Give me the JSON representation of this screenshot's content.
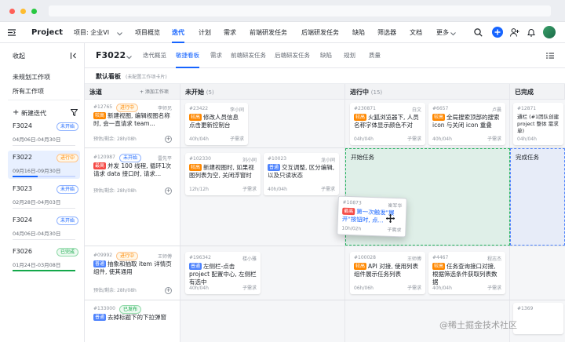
{
  "window": {
    "dots": [
      "#ff5f57",
      "#febc2e",
      "#28c840"
    ]
  },
  "topnav": {
    "app_name": "Project",
    "project_label": "项目: 企业VI",
    "items": [
      "项目概览",
      "迭代",
      "计划",
      "需求",
      "前端研发任务",
      "后端研发任务",
      "缺陷",
      "筛选器",
      "文档"
    ],
    "more": "更多"
  },
  "sidebar": {
    "title": "收起",
    "unplanned": "未规划工作项",
    "all": "所有工作项",
    "new_iteration": "新建迭代",
    "iterations": [
      {
        "name": "F3024",
        "dates": "04月06日-04月30日",
        "status": "未开始",
        "tone": "blue"
      },
      {
        "name": "F3022",
        "dates": "09月16日-09月30日",
        "status": "进行中",
        "tone": "orange"
      },
      {
        "name": "F3023",
        "dates": "02月28日-04月03日",
        "status": "未开始",
        "tone": "blue"
      },
      {
        "name": "F3024",
        "dates": "04月06日-04月30日",
        "status": "未开始",
        "tone": "blue"
      },
      {
        "name": "F3026",
        "dates": "01月24日-03月08日",
        "status": "已完成",
        "tone": "green"
      }
    ]
  },
  "subheader": {
    "iteration": "F3022",
    "tabs": [
      "迭代概览",
      "敏捷看板",
      "需求",
      "前端研发任务",
      "后端研发任务",
      "缺陷",
      "规划",
      "质量"
    ]
  },
  "board": {
    "title": "默认看板",
    "hint": "(未配置工作项卡片)",
    "columns": [
      {
        "name": "泳道",
        "count": ""
      },
      {
        "name": "未开始",
        "count": "(5)"
      },
      {
        "name": "进行中",
        "count": "(15)"
      },
      {
        "name": "已完成",
        "count": ""
      }
    ],
    "lanes": [
      {
        "id": "#12765",
        "status": "进行中",
        "owner": "李师兄",
        "title_tag": "较高",
        "title": "新建视图, 编辑视图名称时, 会一直请求 team...",
        "meta": "预估/剩余: 28h/08h",
        "add": "+ 添加工作项"
      },
      {
        "id": "#120987",
        "status": "未开始",
        "owner": "雷先平",
        "title_tag": "最高",
        "title": "并发 100 线程, 循环1次请求 data 接口时, 请求...",
        "meta": "预估/剩余: 28h/08h"
      },
      {
        "id": "#09992",
        "status": "进行中",
        "owner": "王师傅",
        "title_tag": "普通",
        "title": "抽象和抽取 item 详情页组件, 使其通用",
        "meta": "预估/剩余: 28h/08h"
      },
      {
        "id": "#133000",
        "status": "已发布",
        "owner": "",
        "title_tag": "普通",
        "title": "去掉标题下的下拉弹窗",
        "meta": ""
      }
    ],
    "cards": [
      {
        "id": "#23422",
        "owner": "李小同",
        "tag": "较高",
        "title": "修改人员信息点击更新控制台",
        "meta": "40h/04h",
        "sub": "子需求"
      },
      {
        "id": "#102330",
        "owner": "刘小同",
        "tag": "较高",
        "title": "新建视图时, 如果视图列表为空, 关闭浮窗时",
        "meta": "12h/12h",
        "sub": "子需求"
      },
      {
        "id": "#10023",
        "owner": "龙小同",
        "tag": "普通",
        "title": "交互调整, 区分编辑, 以及只读状态",
        "meta": "40h/04h",
        "sub": "子需求"
      },
      {
        "id": "#196342",
        "owner": "楼小雅",
        "tag": "普通",
        "title": "左侧栏-点击 project 配置中心, 左侧栏有选中",
        "meta": "40h/04h",
        "sub": "子需求"
      },
      {
        "id": "#230871",
        "owner": "白文",
        "tag": "较高",
        "title": "火狐浏览器下, 人员名称字体显示颜色不对",
        "meta": "04h/04h",
        "sub": "子需求"
      },
      {
        "id": "#100028",
        "owner": "王师傅",
        "tag": "较高",
        "title": "API 对接, 使用列表组件展示任务列表",
        "meta": "06h/06h",
        "sub": "子需求"
      },
      {
        "id": "#6657",
        "owner": "卢晨",
        "tag": "较高",
        "title": "全局搜索顶部的搜索 icon 与关闭 icon 重叠",
        "meta": "40h/04h",
        "sub": "子需求"
      },
      {
        "id": "#4467",
        "owner": "程志杰",
        "tag": "较高",
        "title": "任务查询接口对接, 根据筛选条件获取列表数据",
        "meta": "40h/04h",
        "sub": "子需求"
      },
      {
        "id": "#12871",
        "owner": "",
        "tag": "",
        "title": "通栏 (#1团队创建 project 整体 需求单)",
        "meta": "04h/04h",
        "sub": ""
      },
      {
        "id": "#1369",
        "owner": "",
        "tag": "",
        "title": "",
        "meta": "",
        "sub": ""
      }
    ],
    "dragged": {
      "id": "#10873",
      "owner": "崔军华",
      "tag": "最高",
      "title": "第一次触发\"展开\"按钮时, 点...",
      "meta": "10h/02h",
      "sub": "子需求"
    },
    "drop_zones": [
      "开始任务",
      "完成任务"
    ]
  },
  "watermark": "@稀土掘金技术社区"
}
